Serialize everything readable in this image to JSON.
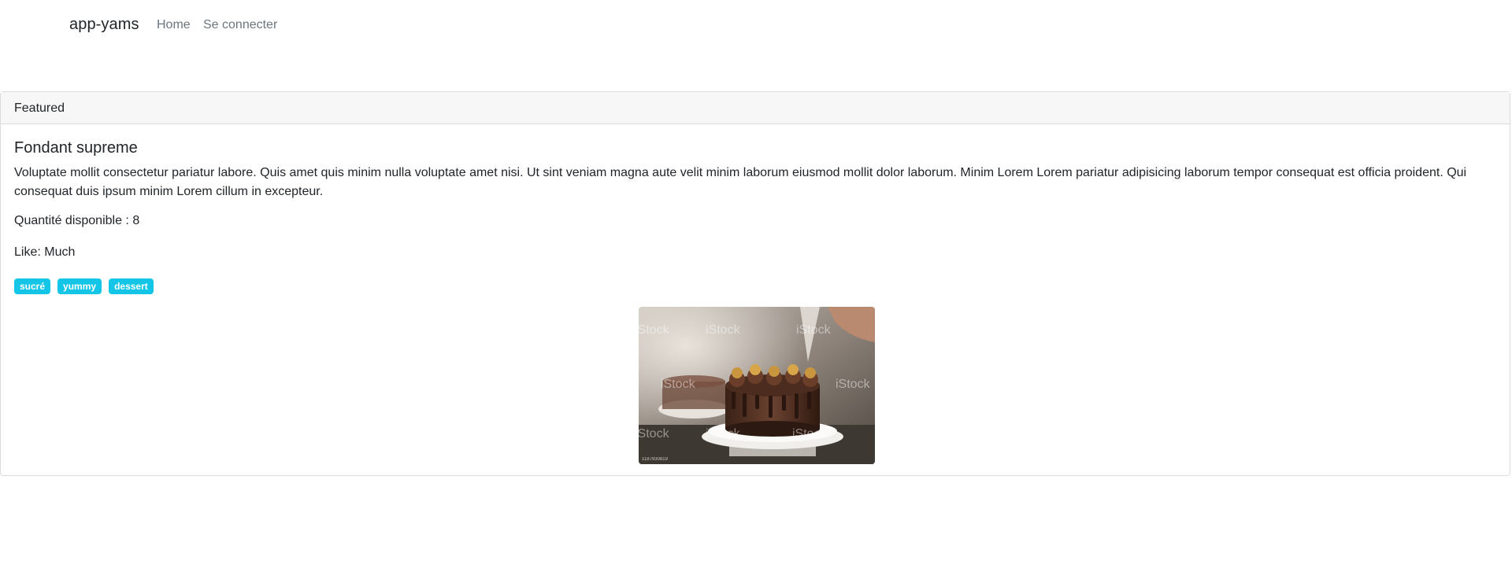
{
  "navbar": {
    "brand": "app-yams",
    "links": [
      {
        "label": "Home"
      },
      {
        "label": "Se connecter"
      }
    ]
  },
  "card": {
    "header": "Featured",
    "title": "Fondant supreme",
    "description": "Voluptate mollit consectetur pariatur labore. Quis amet quis minim nulla voluptate amet nisi. Ut sint veniam magna aute velit minim laborum eiusmod mollit dolor laborum. Minim Lorem Lorem pariatur adipisicing laborum tempor consequat est officia proident. Qui consequat duis ipsum minim Lorem cillum in excepteur.",
    "quantity": "Quantité disponible : 8",
    "like": "Like: Much",
    "tags": [
      "sucré",
      "yummy",
      "dessert"
    ],
    "tag_color": "#13c5e6",
    "image": {
      "subject": "chocolate-cake-photo",
      "watermark": "iStock",
      "watermark_sub": "by Getty Images",
      "stock_id": "1187930819"
    }
  }
}
